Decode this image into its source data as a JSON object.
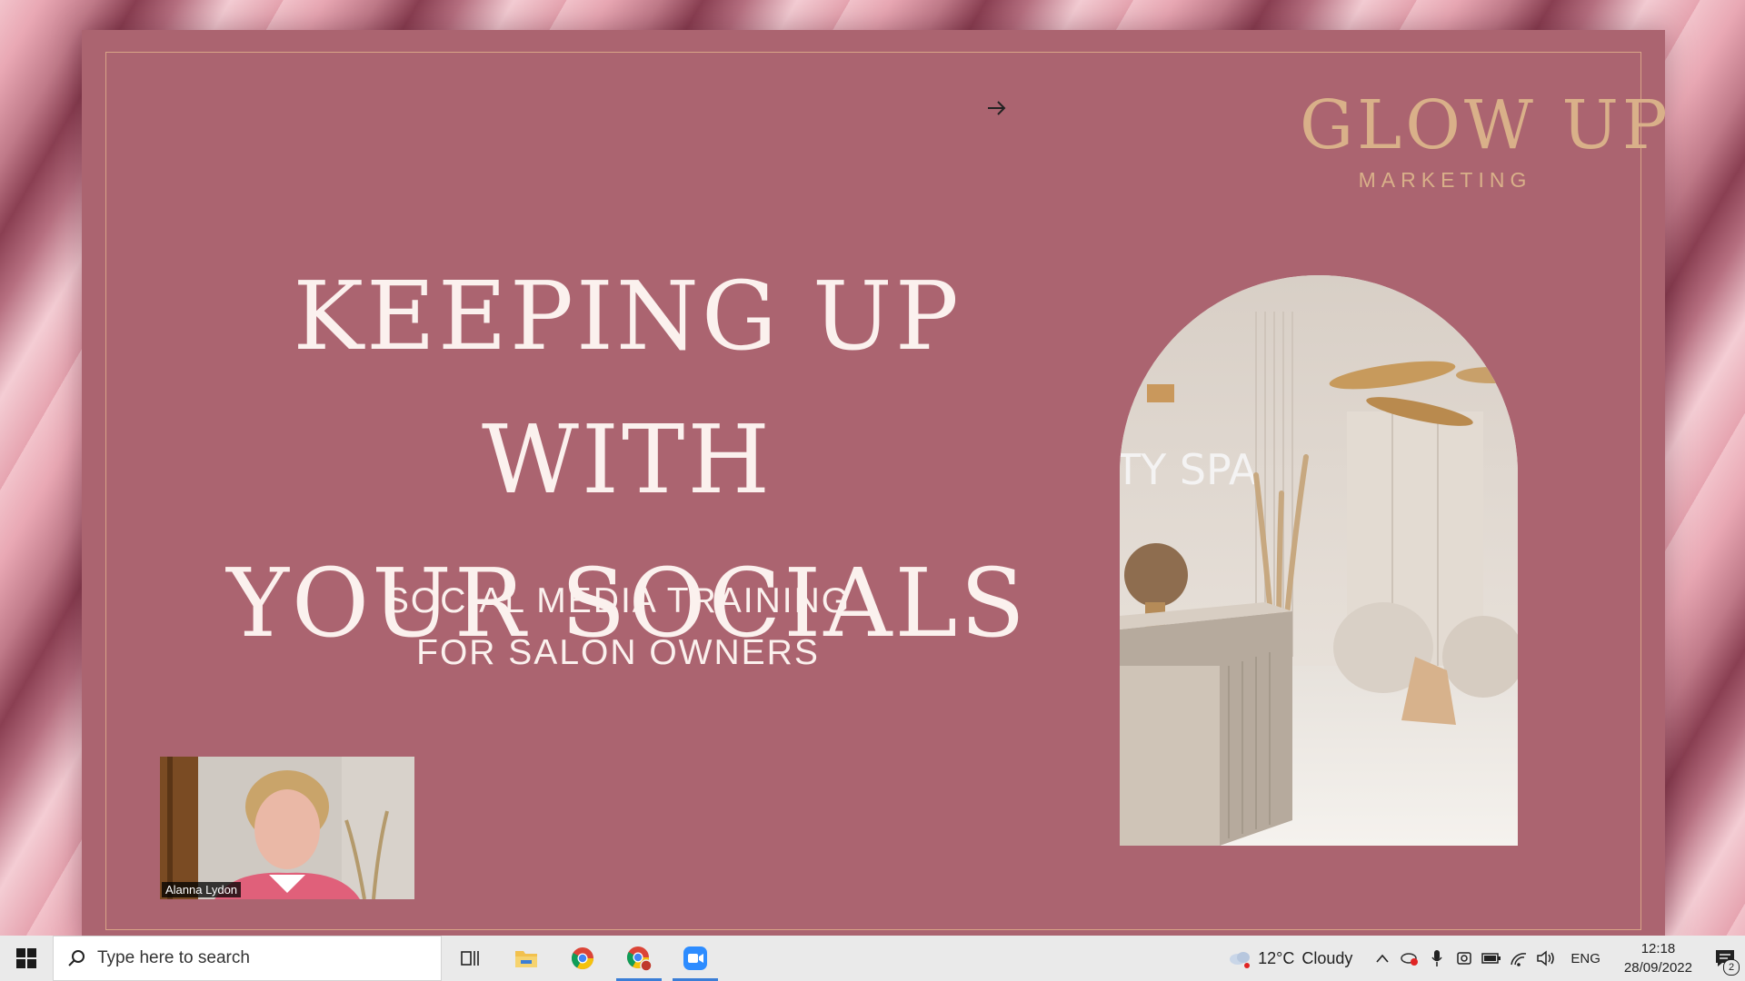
{
  "slide": {
    "logo_main": "GLOW UP",
    "logo_sub": "MARKETING",
    "title_line1": "KEEPING UP WITH",
    "title_line2": "YOUR SOCIALS",
    "subtitle_line1": "SOCIAL MEDIA TRAINING",
    "subtitle_line2": "FOR SALON OWNERS",
    "arch_sign": "TY SPA"
  },
  "webcam": {
    "participant_name": "Alanna Lydon"
  },
  "taskbar": {
    "search_placeholder": "Type here to search",
    "weather_temp": "12°C",
    "weather_desc": "Cloudy",
    "language": "ENG",
    "time": "12:18",
    "date": "28/09/2022",
    "notification_count": "2"
  },
  "colors": {
    "slide_bg": "#ab6470",
    "gold": "#d9b089",
    "title_text": "#fbf1ee",
    "taskbar_bg": "#eaeaea"
  }
}
